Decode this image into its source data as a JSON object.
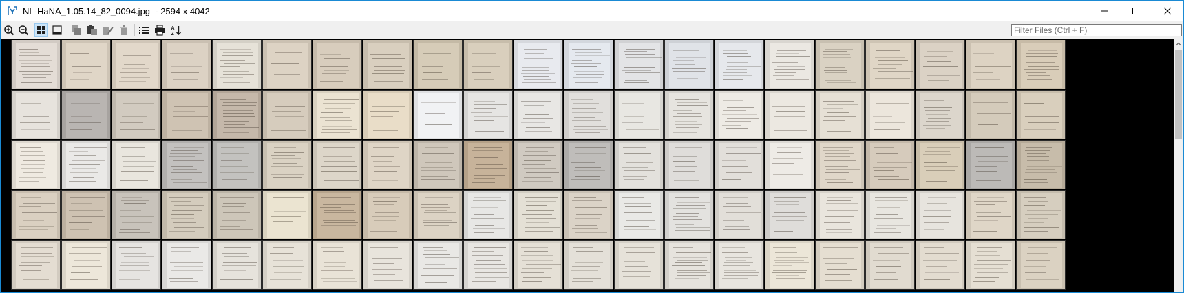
{
  "window": {
    "title": "NL-HaNA_1.05.14_82_0094.jpg  - 2594 x 4042",
    "icon": "app-icon",
    "buttons": [
      "minimize-icon",
      "maximize-icon",
      "close-icon"
    ]
  },
  "toolbar": {
    "buttons": [
      {
        "name": "zoom-in-button",
        "icon": "zoom-in-icon"
      },
      {
        "name": "zoom-out-button",
        "icon": "zoom-out-icon"
      },
      {
        "name": "thumbnail-view-button",
        "icon": "grid-view-icon",
        "active": true
      },
      {
        "name": "filmstrip-view-button",
        "icon": "filmstrip-icon"
      },
      {
        "name": "copy-button",
        "icon": "copy-icon"
      },
      {
        "name": "paste-button",
        "icon": "paste-icon"
      },
      {
        "name": "rename-button",
        "icon": "pencil-icon"
      },
      {
        "name": "delete-button",
        "icon": "trash-icon"
      },
      {
        "name": "list-view-button",
        "icon": "list-icon"
      },
      {
        "name": "print-button",
        "icon": "printer-icon"
      },
      {
        "name": "sort-button",
        "icon": "sort-az-icon"
      }
    ],
    "filter_placeholder": "Filter Files (Ctrl + F)"
  },
  "thumbnails": {
    "columns": 21,
    "rows": 5,
    "tones": [
      [
        "#e4ddd6",
        "#e0d6c7",
        "#e2d8ca",
        "#dcd2c4",
        "#e6e2d8",
        "#ddd3c4",
        "#d8cdbd",
        "#d9cfbf",
        "#d6ccb8",
        "#d9cfbd",
        "#e8eaef",
        "#e5e9ef",
        "#e3e4e6",
        "#e0e3e8",
        "#e6e8ec",
        "#ebe8e2",
        "#dad2c3",
        "#e0d6c6",
        "#dbd2c5",
        "#ddd3c3",
        "#d9cdb9"
      ],
      [
        "#e7e3dd",
        "#b9b5b2",
        "#d2cbc0",
        "#cfc3b3",
        "#c5b8aa",
        "#d6ccbd",
        "#ebe3d2",
        "#e9ddc8",
        "#f1f2f4",
        "#e6e5e3",
        "#e8e7e4",
        "#e1dfdc",
        "#e8e7e2",
        "#e6e4df",
        "#eeebe5",
        "#ece8e1",
        "#e6e0d5",
        "#ece6dc",
        "#dcd6cc",
        "#d4cbbb",
        "#d9cfbd"
      ],
      [
        "#efeae1",
        "#eae9e7",
        "#e9e6de",
        "#c3c1bf",
        "#c3c2bf",
        "#dad2c3",
        "#ddd6c9",
        "#dfd5c6",
        "#cfc7bb",
        "#c7b39a",
        "#d0cac1",
        "#bfbdba",
        "#e3e1dc",
        "#dfddda",
        "#e2dfda",
        "#eeebe6",
        "#e0d7c9",
        "#d6cbbc",
        "#d9ceb9",
        "#bcbab7",
        "#c7bcaa"
      ],
      [
        "#dad0c1",
        "#cec2b2",
        "#c8c3bb",
        "#d4ccbd",
        "#cdc6b9",
        "#ebe4d1",
        "#c9b79f",
        "#d8ccba",
        "#dcd3c4",
        "#e7e7e5",
        "#e4e0d5",
        "#dbd3c7",
        "#e9e9e6",
        "#e3e2df",
        "#e2dfd9",
        "#dfddda",
        "#e9e5dd",
        "#e8e6e0",
        "#e7e4de",
        "#dfd6c7",
        "#d6cebf"
      ],
      [
        "#e4ddd2",
        "#ede7da",
        "#e6e4e1",
        "#eae9e7",
        "#e6e3dc",
        "#e7e2d8",
        "#e9e3d7",
        "#e8e4dc",
        "#e9e8e5",
        "#e8e6e2",
        "#e5e0d6",
        "#e4e0d8",
        "#e6e2d9",
        "#e6e3dd",
        "#e8e5df",
        "#ece6d8",
        "#e5ded1",
        "#e1dbd0",
        "#e3dcd0",
        "#e5dfd3",
        "#dbd2c2"
      ]
    ]
  }
}
